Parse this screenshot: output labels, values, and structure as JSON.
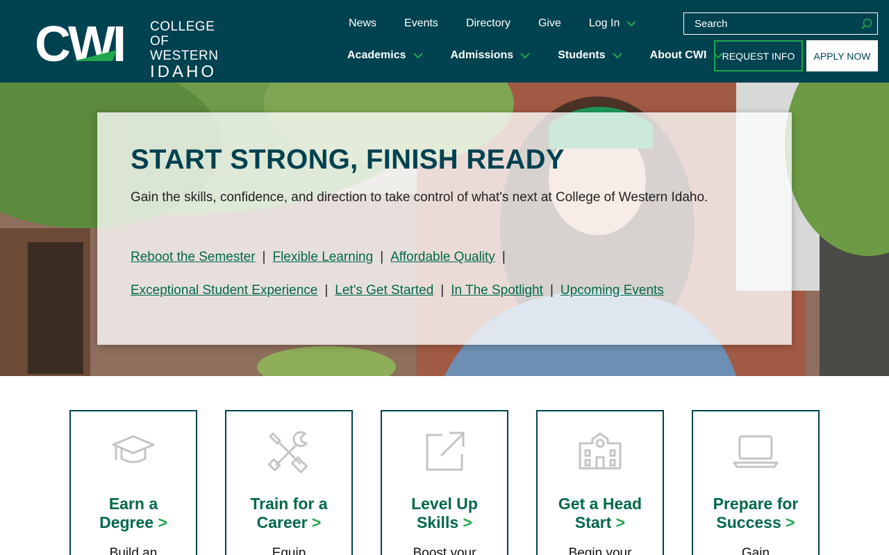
{
  "header": {
    "logo": {
      "mark": "CWI",
      "line1": "COLLEGE OF",
      "line2": "WESTERN",
      "line3": "IDAHO"
    },
    "top_nav": [
      {
        "label": "News"
      },
      {
        "label": "Events"
      },
      {
        "label": "Directory"
      },
      {
        "label": "Give"
      },
      {
        "label": "Log In"
      }
    ],
    "search": {
      "placeholder": "Search"
    },
    "main_nav": [
      {
        "label": "Academics"
      },
      {
        "label": "Admissions"
      },
      {
        "label": "Students"
      },
      {
        "label": "About CWI"
      }
    ],
    "request_info": "REQUEST INFO",
    "apply_now": "APPLY NOW",
    "colors": {
      "bg": "#004250",
      "accent": "#1fa84e"
    }
  },
  "hero": {
    "title": "START STRONG, FINISH READY",
    "subtitle": "Gain the skills, confidence, and direction to take control of what's next at College of Western Idaho.",
    "links": [
      "Reboot the Semester",
      "Flexible Learning",
      "Affordable Quality",
      "Exceptional Student Experience",
      "Let's Get Started",
      "In The Spotlight",
      "Upcoming Events"
    ],
    "separator": "|"
  },
  "cards": [
    {
      "icon": "graduation-cap-icon",
      "title": "Earn a Degree",
      "arrow": ">",
      "desc": "Build an"
    },
    {
      "icon": "tools-icon",
      "title": "Train for a Career",
      "arrow": ">",
      "desc": "Equip"
    },
    {
      "icon": "external-link-icon",
      "title": "Level Up Skills",
      "arrow": ">",
      "desc": "Boost your"
    },
    {
      "icon": "school-building-icon",
      "title": "Get a Head Start",
      "arrow": ">",
      "desc": "Begin your"
    },
    {
      "icon": "laptop-icon",
      "title": "Prepare for Success",
      "arrow": ">",
      "desc": "Gain"
    }
  ]
}
